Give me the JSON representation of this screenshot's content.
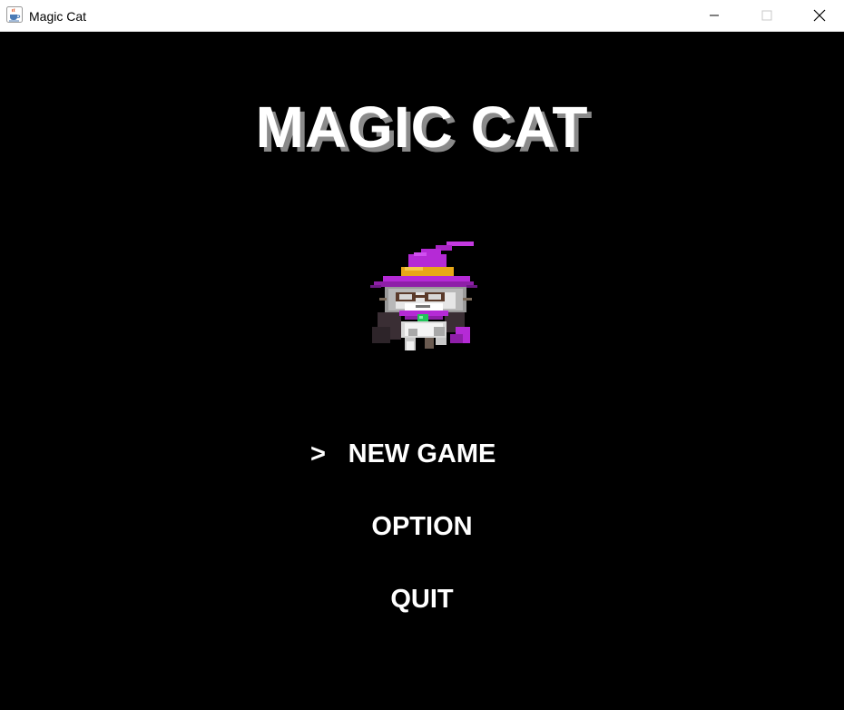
{
  "window": {
    "title": "Magic Cat",
    "app_icon": "java-cup-icon",
    "controls": [
      "minimize-icon",
      "maximize-icon",
      "close-icon"
    ]
  },
  "game": {
    "title": "MAGIC CAT",
    "sprite": "witch-cat-sprite",
    "menu": {
      "cursor": ">",
      "selected_index": 0,
      "items": [
        "NEW GAME",
        "OPTION",
        "QUIT"
      ]
    }
  },
  "colors": {
    "background": "#000000",
    "text": "#ffffff",
    "title_shadow": "#8a8a8a",
    "hat": "#b52ad6",
    "hat_band": "#e8a818",
    "gem": "#22c45a"
  }
}
